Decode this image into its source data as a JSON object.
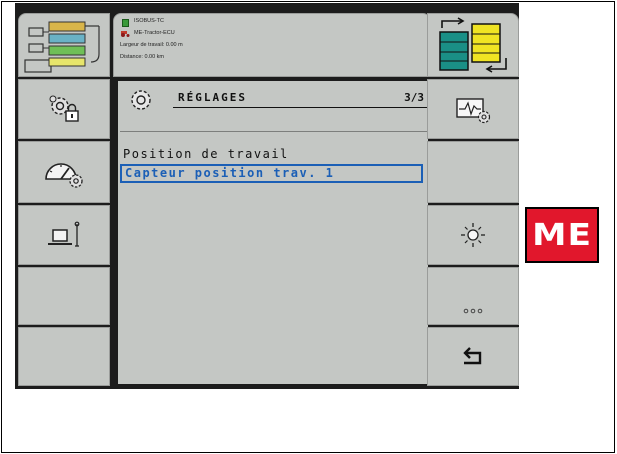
{
  "header": {
    "line1": "ISOBUS-TC",
    "line2": "ME-Tractor-ECU",
    "line3": "Largeur de travail: 0.00  m",
    "line4": "Distance: 0.00  km"
  },
  "screen": {
    "title": "RÉGLAGES",
    "page_indicator": "3/3"
  },
  "setting": {
    "label": "Position de travail",
    "value": "Capteur position trav. 1"
  },
  "softkeys_left": [
    {
      "icon": "settings-lock-icon"
    },
    {
      "icon": "speedometer-settings-icon"
    },
    {
      "icon": "position-sensor-icon"
    },
    {
      "icon": "empty"
    },
    {
      "icon": "empty"
    }
  ],
  "softkeys_right": [
    {
      "icon": "diagnostics-settings-icon"
    },
    {
      "icon": "empty"
    },
    {
      "icon": "light-icon"
    },
    {
      "icon": "more-icon"
    },
    {
      "icon": "back-icon"
    }
  ],
  "logo": {
    "text": "ME",
    "color": "#e1172c"
  },
  "colors": {
    "highlight": "#1b5fb6",
    "panel": "#c4c7c4"
  }
}
